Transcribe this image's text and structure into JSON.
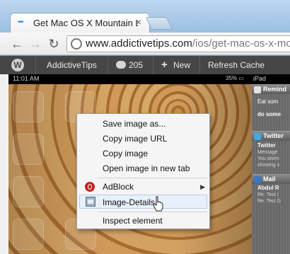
{
  "tab": {
    "title": "Get Mac OS X Mountain Lio",
    "favicon": "•••",
    "close": "×"
  },
  "toolbar": {
    "back": "←",
    "forward": "→",
    "reload": "↻",
    "url_host": "www.addictivetips.com",
    "url_path": "/ios/get-mac-os-x-mou"
  },
  "adminbar": {
    "wp_logo": "W",
    "site_name": "AddictiveTips",
    "comments_count": "205",
    "new_plus": "+",
    "new_label": "New",
    "refresh_cache": "Refresh Cache"
  },
  "ipad": {
    "time": "11:01 AM",
    "battery": "35% ▭",
    "label": "iPad",
    "notifications": [
      {
        "app": "Remind",
        "lines": [
          {
            "text": "Eat som",
            "bold": false
          },
          {
            "text": "do some",
            "bold": true
          }
        ],
        "color": "#e2e2e2"
      },
      {
        "app": "Twitter",
        "lines": [
          {
            "text": "Twitter",
            "bold": true
          },
          {
            "text": "Message",
            "bold": false
          },
          {
            "text": "You seem",
            "bold": false
          },
          {
            "text": "showing s",
            "bold": false
          }
        ],
        "color": "#3fa9e6"
      },
      {
        "app": "Mail",
        "lines": [
          {
            "text": "Abdul R",
            "bold": true
          },
          {
            "text": "Re: Test (",
            "bold": false
          },
          {
            "text": "Re: Test G",
            "bold": false
          }
        ],
        "color": "#3a78c6"
      }
    ]
  },
  "context_menu": {
    "save_image": "Save image as...",
    "copy_url": "Copy image URL",
    "copy_image": "Copy image",
    "open_tab": "Open image in new tab",
    "adblock": "AdBlock",
    "adblock_arrow": "▶",
    "image_details": "Image-Details",
    "inspect": "Inspect element"
  }
}
